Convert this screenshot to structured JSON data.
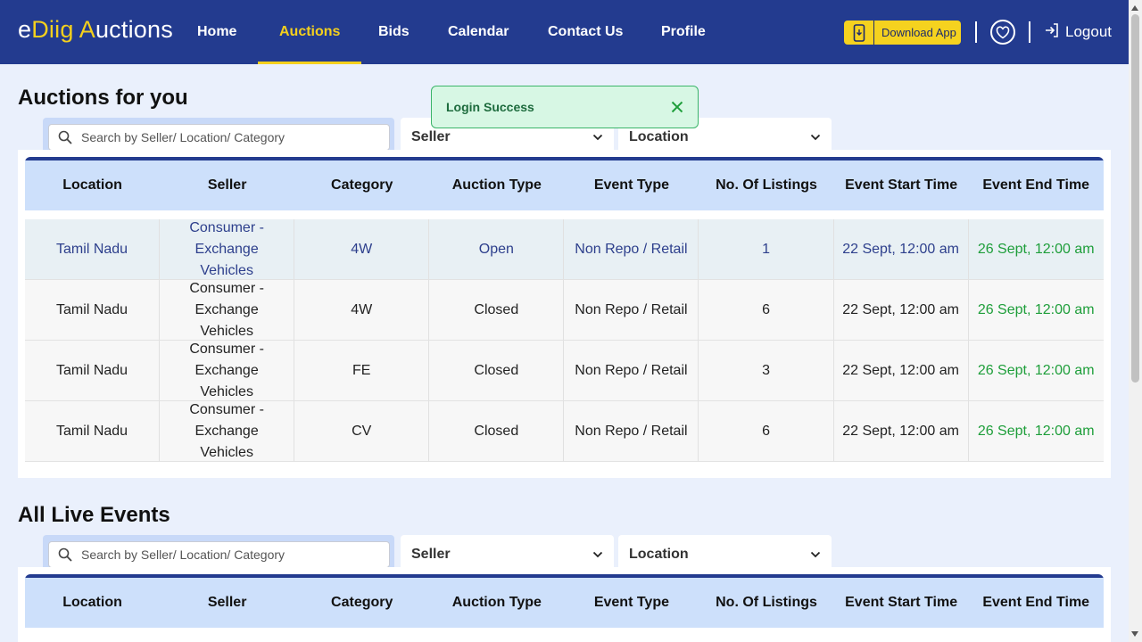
{
  "header": {
    "logo": {
      "part1": "e",
      "part2": "Diig ",
      "part3": "A",
      "part4": "uctions"
    },
    "nav": [
      "Home",
      "Auctions",
      "Bids",
      "Calendar",
      "Contact Us",
      "Profile"
    ],
    "download_label": "Download App",
    "logout_label": "Logout"
  },
  "colors": {
    "header_bg": "#233b8f",
    "accent": "#f4d01d",
    "end_time": "#1e9e3a",
    "toast_bg": "#d7f7e4"
  },
  "toast": {
    "message": "Login Success"
  },
  "auctions_for_you": {
    "title": "Auctions for you",
    "search_placeholder": "Search by Seller/ Location/ Category",
    "seller_select": "Seller",
    "location_select": "Location",
    "columns": [
      "Location",
      "Seller",
      "Category",
      "Auction Type",
      "Event Type",
      "No. Of Listings",
      "Event Start Time",
      "Event End Time"
    ],
    "rows": [
      [
        "Tamil Nadu",
        "Consumer - Exchange Vehicles",
        "4W",
        "Open",
        "Non Repo / Retail",
        "1",
        "22 Sept, 12:00 am",
        "26 Sept, 12:00 am"
      ],
      [
        "Tamil Nadu",
        "Consumer - Exchange Vehicles",
        "4W",
        "Closed",
        "Non Repo / Retail",
        "6",
        "22 Sept, 12:00 am",
        "26 Sept, 12:00 am"
      ],
      [
        "Tamil Nadu",
        "Consumer - Exchange Vehicles",
        "FE",
        "Closed",
        "Non Repo / Retail",
        "3",
        "22 Sept, 12:00 am",
        "26 Sept, 12:00 am"
      ],
      [
        "Tamil Nadu",
        "Consumer - Exchange Vehicles",
        "CV",
        "Closed",
        "Non Repo / Retail",
        "6",
        "22 Sept, 12:00 am",
        "26 Sept, 12:00 am"
      ]
    ]
  },
  "all_live_events": {
    "title": "All Live Events",
    "search_placeholder": "Search by Seller/ Location/ Category",
    "seller_select": "Seller",
    "location_select": "Location",
    "columns": [
      "Location",
      "Seller",
      "Category",
      "Auction Type",
      "Event Type",
      "No. Of Listings",
      "Event Start Time",
      "Event End Time"
    ]
  }
}
